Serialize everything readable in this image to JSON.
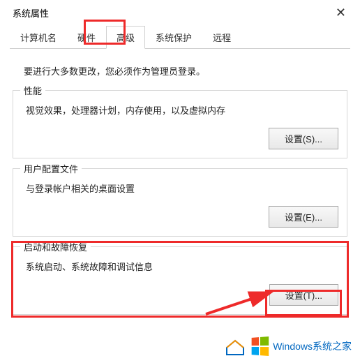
{
  "window": {
    "title": "系统属性"
  },
  "tabs": {
    "computer_name": "计算机名",
    "hardware": "硬件",
    "advanced": "高级",
    "system_protection": "系统保护",
    "remote": "远程"
  },
  "notice": "要进行大多数更改，您必须作为管理员登录。",
  "groups": {
    "performance": {
      "title": "性能",
      "text": "视觉效果，处理器计划，内存使用，以及虚拟内存",
      "button": "设置(S)..."
    },
    "user_profiles": {
      "title": "用户配置文件",
      "text": "与登录帐户相关的桌面设置",
      "button": "设置(E)..."
    },
    "startup_recovery": {
      "title": "启动和故障恢复",
      "text": "系统启动、系统故障和调试信息",
      "button": "设置(T)..."
    }
  },
  "watermark": "Windows系统之家"
}
